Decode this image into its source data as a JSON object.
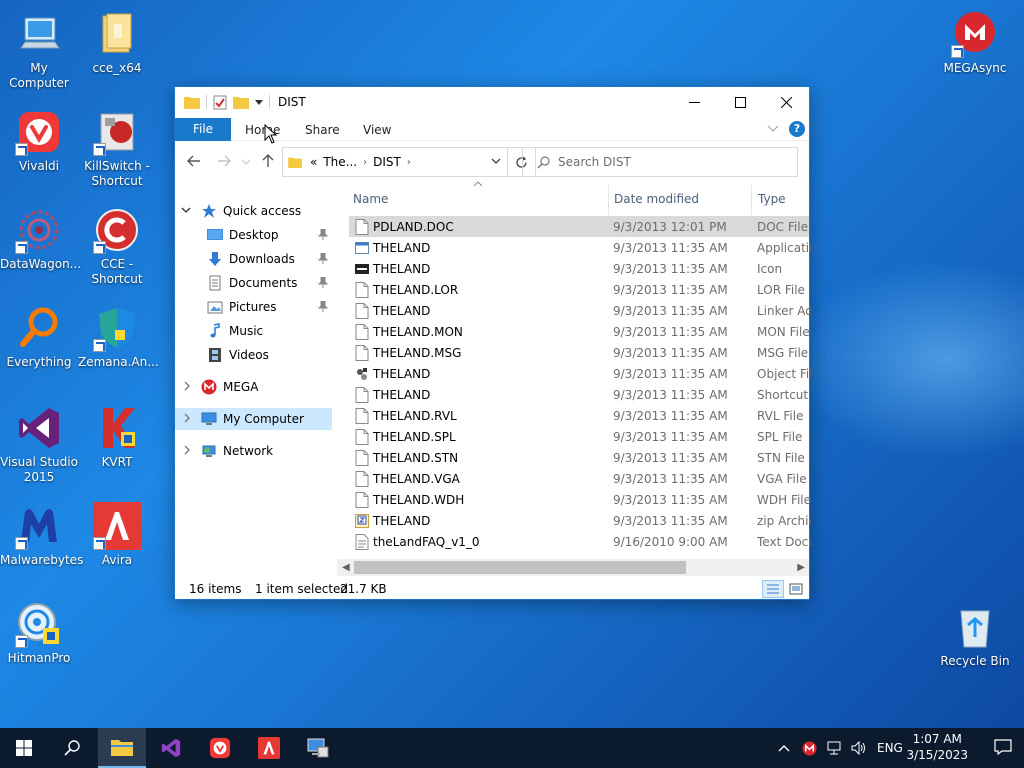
{
  "desktop": {
    "icons": [
      {
        "label": "My Computer"
      },
      {
        "label": "cce_x64"
      },
      {
        "label": "Vivaldi"
      },
      {
        "label": "KillSwitch - Shortcut"
      },
      {
        "label": "DataWagon..."
      },
      {
        "label": "CCE - Shortcut"
      },
      {
        "label": "Everything"
      },
      {
        "label": "Zemana.An..."
      },
      {
        "label": "Visual Studio 2015"
      },
      {
        "label": "KVRT"
      },
      {
        "label": "Malwarebytes"
      },
      {
        "label": "Avira"
      },
      {
        "label": "HitmanPro"
      },
      {
        "label": "MEGAsync"
      },
      {
        "label": "Recycle Bin"
      }
    ]
  },
  "window": {
    "title": "DIST",
    "ribbon": {
      "file": "File",
      "home": "Home",
      "share": "Share",
      "view": "View",
      "help": "?"
    },
    "address": {
      "parent": "The...",
      "current": "DIST",
      "prefix": "«"
    },
    "search": {
      "placeholder": "Search DIST"
    },
    "nav": {
      "quick_access": "Quick access",
      "desktop": "Desktop",
      "downloads": "Downloads",
      "documents": "Documents",
      "pictures": "Pictures",
      "music": "Music",
      "videos": "Videos",
      "mega": "MEGA",
      "my_computer": "My Computer",
      "network": "Network"
    },
    "columns": {
      "name": "Name",
      "date": "Date modified",
      "type": "Type"
    },
    "files": [
      {
        "name": "PDLAND.DOC",
        "date": "9/3/2013 12:01 PM",
        "type": "DOC File",
        "icon": "doc"
      },
      {
        "name": "THELAND",
        "date": "9/3/2013 11:35 AM",
        "type": "Applicatio",
        "icon": "app"
      },
      {
        "name": "THELAND",
        "date": "9/3/2013 11:35 AM",
        "type": "Icon",
        "icon": "ico"
      },
      {
        "name": "THELAND.LOR",
        "date": "9/3/2013 11:35 AM",
        "type": "LOR File",
        "icon": "doc"
      },
      {
        "name": "THELAND",
        "date": "9/3/2013 11:35 AM",
        "type": "Linker Ad",
        "icon": "doc"
      },
      {
        "name": "THELAND.MON",
        "date": "9/3/2013 11:35 AM",
        "type": "MON File",
        "icon": "doc"
      },
      {
        "name": "THELAND.MSG",
        "date": "9/3/2013 11:35 AM",
        "type": "MSG File",
        "icon": "doc"
      },
      {
        "name": "THELAND",
        "date": "9/3/2013 11:35 AM",
        "type": "Object File",
        "icon": "obj"
      },
      {
        "name": "THELAND",
        "date": "9/3/2013 11:35 AM",
        "type": "Shortcut t",
        "icon": "doc"
      },
      {
        "name": "THELAND.RVL",
        "date": "9/3/2013 11:35 AM",
        "type": "RVL File",
        "icon": "doc"
      },
      {
        "name": "THELAND.SPL",
        "date": "9/3/2013 11:35 AM",
        "type": "SPL File",
        "icon": "doc"
      },
      {
        "name": "THELAND.STN",
        "date": "9/3/2013 11:35 AM",
        "type": "STN File",
        "icon": "doc"
      },
      {
        "name": "THELAND.VGA",
        "date": "9/3/2013 11:35 AM",
        "type": "VGA File",
        "icon": "doc"
      },
      {
        "name": "THELAND.WDH",
        "date": "9/3/2013 11:35 AM",
        "type": "WDH File",
        "icon": "doc"
      },
      {
        "name": "THELAND",
        "date": "9/3/2013 11:35 AM",
        "type": "zip Archiv",
        "icon": "zip"
      },
      {
        "name": "theLandFAQ_v1_0",
        "date": "9/16/2010 9:00 AM",
        "type": "Text Docu",
        "icon": "txt"
      }
    ],
    "status": {
      "count": "16 items",
      "selected": "1 item selected",
      "size": "21.7 KB"
    }
  },
  "taskbar": {
    "lang": "ENG",
    "time": "1:07 AM",
    "date": "3/15/2023"
  },
  "colors": {
    "accent": "#1979ca",
    "selection": "#cce8ff",
    "taskbar": "#0b1a2c"
  }
}
